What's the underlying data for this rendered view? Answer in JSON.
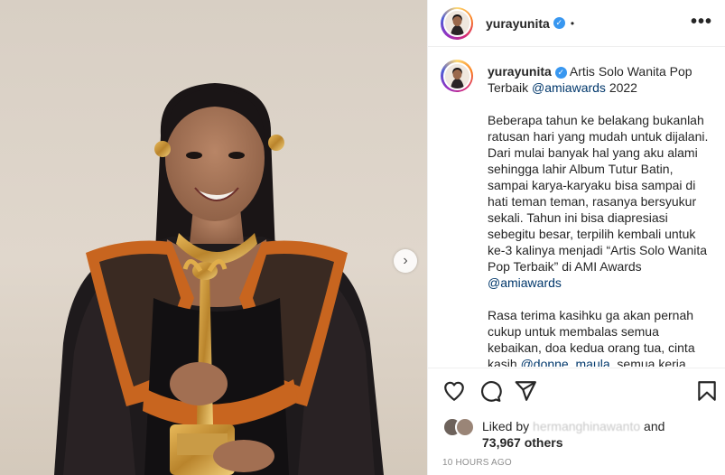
{
  "post": {
    "media_alt": "",
    "next_icon": "chevron-right-icon",
    "next_glyph": "›"
  },
  "header": {
    "username": "yurayunita",
    "verified_glyph": "✓",
    "separator": "•",
    "more_glyph": "•••"
  },
  "caption": {
    "username": "yurayunita",
    "title_before": " Artis Solo Wanita Pop Terbaik ",
    "title_mention": "@amiawards",
    "title_after": " 2022",
    "para1": "Beberapa tahun ke belakang bukanlah ratusan hari yang mudah untuk dijalani. Dari mulai banyak hal yang aku alami sehingga lahir Album Tutur Batin, sampai karya-karyaku bisa sampai di hati teman teman, rasanya bersyukur sekali. Tahun ini bisa diapresiasi sebegitu besar, terpilih kembali untuk ke-3 kalinya menjadi “Artis Solo Wanita Pop Terbaik” di AMI Awards ",
    "para1_mention": "@amiawards",
    "para2": "Rasa terima kasihku ga akan pernah cukup untuk membalas semua kebaikan, doa kedua orang tua, cinta kasih ",
    "para2_mention": "@donne_maula",
    "para2_after": ", semua kerja"
  },
  "actions": {
    "like_icon": "heart-icon",
    "comment_icon": "comment-icon",
    "share_icon": "share-icon",
    "save_icon": "bookmark-icon"
  },
  "likes": {
    "prefix": "Liked by ",
    "obscured_name": "hermanghinawanto",
    "suffix": " and",
    "count": "73,967 others"
  },
  "timestamp": "10 HOURS AGO",
  "colors": {
    "accent_link": "#00376b",
    "verified": "#3897f0",
    "muted": "#8e8e8e",
    "costume_orange": "#c8651f"
  }
}
